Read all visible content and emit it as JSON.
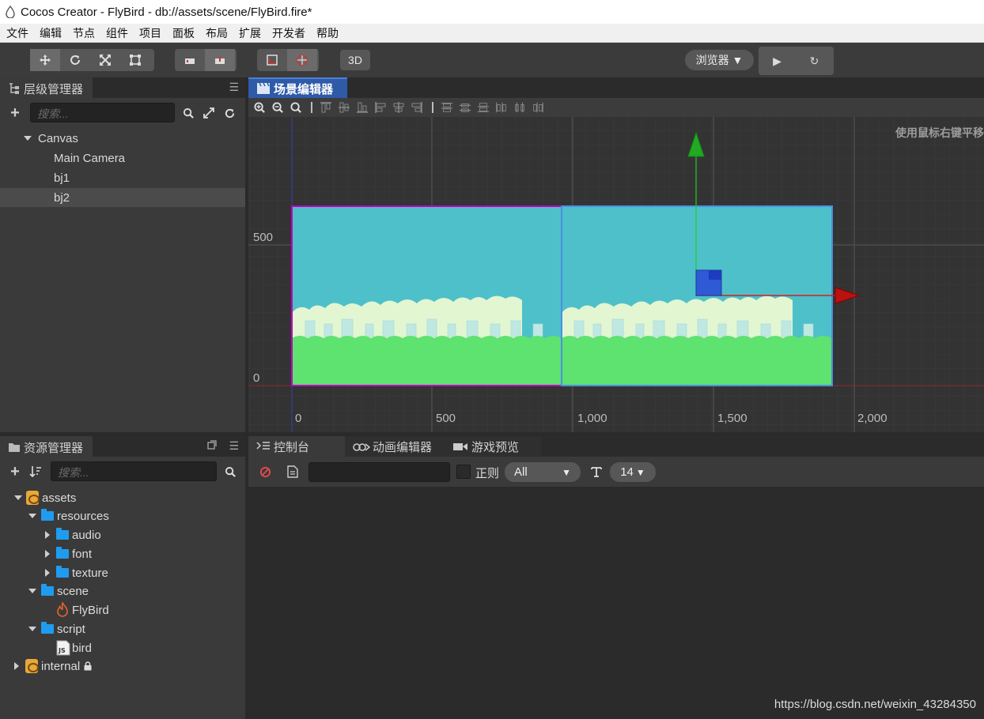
{
  "window": {
    "title": "Cocos Creator - FlyBird - db://assets/scene/FlyBird.fire*"
  },
  "menu": [
    "文件",
    "编辑",
    "节点",
    "组件",
    "项目",
    "面板",
    "布局",
    "扩展",
    "开发者",
    "帮助"
  ],
  "toolbar": {
    "transform_tools": [
      "move-icon",
      "rotate-icon",
      "scale-icon",
      "rect-icon"
    ],
    "anchor_tools": [
      "pivot-icon",
      "center-icon"
    ],
    "coord_tools": [
      "local-icon",
      "global-icon"
    ],
    "mode_3d": "3D",
    "browser_select": "浏览器 ▼",
    "play": "▶",
    "refresh": "↻"
  },
  "hierarchy": {
    "title": "层级管理器",
    "search_placeholder": "搜索...",
    "nodes": [
      {
        "label": "Canvas",
        "level": 0,
        "expanded": true
      },
      {
        "label": "Main Camera",
        "level": 1
      },
      {
        "label": "bj1",
        "level": 1
      },
      {
        "label": "bj2",
        "level": 1,
        "selected": true
      }
    ]
  },
  "scene_editor": {
    "title": "场景编辑器",
    "hint": "使用鼠标右键平移",
    "y_labels": [
      "500",
      "0"
    ],
    "x_labels": [
      "0",
      "500",
      "1,000",
      "1,500",
      "2,000"
    ]
  },
  "assets": {
    "title": "资源管理器",
    "search_placeholder": "搜索...",
    "items": [
      {
        "label": "assets",
        "level": 0,
        "type": "db",
        "caret": "down"
      },
      {
        "label": "resources",
        "level": 1,
        "type": "folder",
        "caret": "down"
      },
      {
        "label": "audio",
        "level": 2,
        "type": "folder",
        "caret": "right"
      },
      {
        "label": "font",
        "level": 2,
        "type": "folder",
        "caret": "right"
      },
      {
        "label": "texture",
        "level": 2,
        "type": "folder",
        "caret": "right"
      },
      {
        "label": "scene",
        "level": 1,
        "type": "folder",
        "caret": "down"
      },
      {
        "label": "FlyBird",
        "level": 2,
        "type": "fire"
      },
      {
        "label": "script",
        "level": 1,
        "type": "folder",
        "caret": "down"
      },
      {
        "label": "bird",
        "level": 2,
        "type": "js"
      },
      {
        "label": "internal",
        "level": 0,
        "type": "db",
        "caret": "right",
        "locked": true
      }
    ]
  },
  "console": {
    "tabs": [
      "控制台",
      "动画编辑器",
      "游戏预览"
    ],
    "regex_label": "正则",
    "filter_value": "All",
    "font_size": "14"
  },
  "watermark": "https://blog.csdn.net/weixin_43284350",
  "colors": {
    "accent": "#2e5aa8",
    "sky": "#4ec0ca",
    "ground": "#5ee270",
    "selection": "#c000c0"
  }
}
